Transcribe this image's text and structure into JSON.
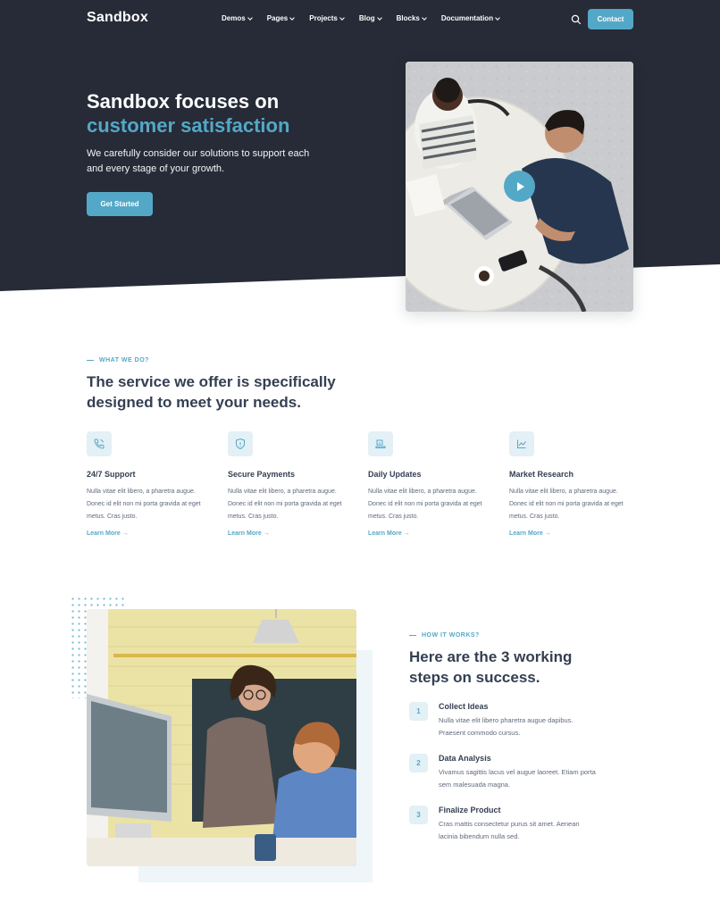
{
  "nav": {
    "logo": "Sandbox",
    "items": [
      "Demos",
      "Pages",
      "Projects",
      "Blog",
      "Blocks",
      "Documentation"
    ],
    "contact_label": "Contact",
    "search_icon": "search-icon"
  },
  "hero": {
    "title_line1": "Sandbox focuses on",
    "title_line2": "customer satisfaction",
    "text": "We carefully consider our solutions to support each and every stage of your growth.",
    "cta_label": "Get Started",
    "play_icon": "play-icon"
  },
  "services": {
    "eyebrow": "WHAT WE DO?",
    "title": "The service we offer is specifically designed to meet your needs.",
    "items": [
      {
        "icon": "phone-icon",
        "title": "24/7 Support",
        "text": "Nulla vitae elit libero, a pharetra augue. Donec id elit non mi porta gravida at eget metus. Cras justo.",
        "link": "Learn More →"
      },
      {
        "icon": "shield-icon",
        "title": "Secure Payments",
        "text": "Nulla vitae elit libero, a pharetra augue. Donec id elit non mi porta gravida at eget metus. Cras justo.",
        "link": "Learn More →"
      },
      {
        "icon": "laptop-icon",
        "title": "Daily Updates",
        "text": "Nulla vitae elit libero, a pharetra augue. Donec id elit non mi porta gravida at eget metus. Cras justo.",
        "link": "Learn More →"
      },
      {
        "icon": "chart-icon",
        "title": "Market Research",
        "text": "Nulla vitae elit libero, a pharetra augue. Donec id elit non mi porta gravida at eget metus. Cras justo.",
        "link": "Learn More →"
      }
    ]
  },
  "how": {
    "eyebrow": "HOW IT WORKS?",
    "title": "Here are the 3 working steps on success.",
    "steps": [
      {
        "num": "1",
        "title": "Collect Ideas",
        "text": "Nulla vitae elit libero pharetra augue dapibus. Praesent commodo cursus."
      },
      {
        "num": "2",
        "title": "Data Analysis",
        "text": "Vivamus sagittis lacus vel augue laoreet. Etiam porta sem malesuada magna."
      },
      {
        "num": "3",
        "title": "Finalize Product",
        "text": "Cras mattis consectetur purus sit amet. Aenean lacinia bibendum nulla sed."
      }
    ]
  },
  "colors": {
    "accent": "#54a8c7",
    "dark": "#262b37",
    "text": "#343f52",
    "muted": "#60697b",
    "icon_bg": "#e3f0f5"
  }
}
